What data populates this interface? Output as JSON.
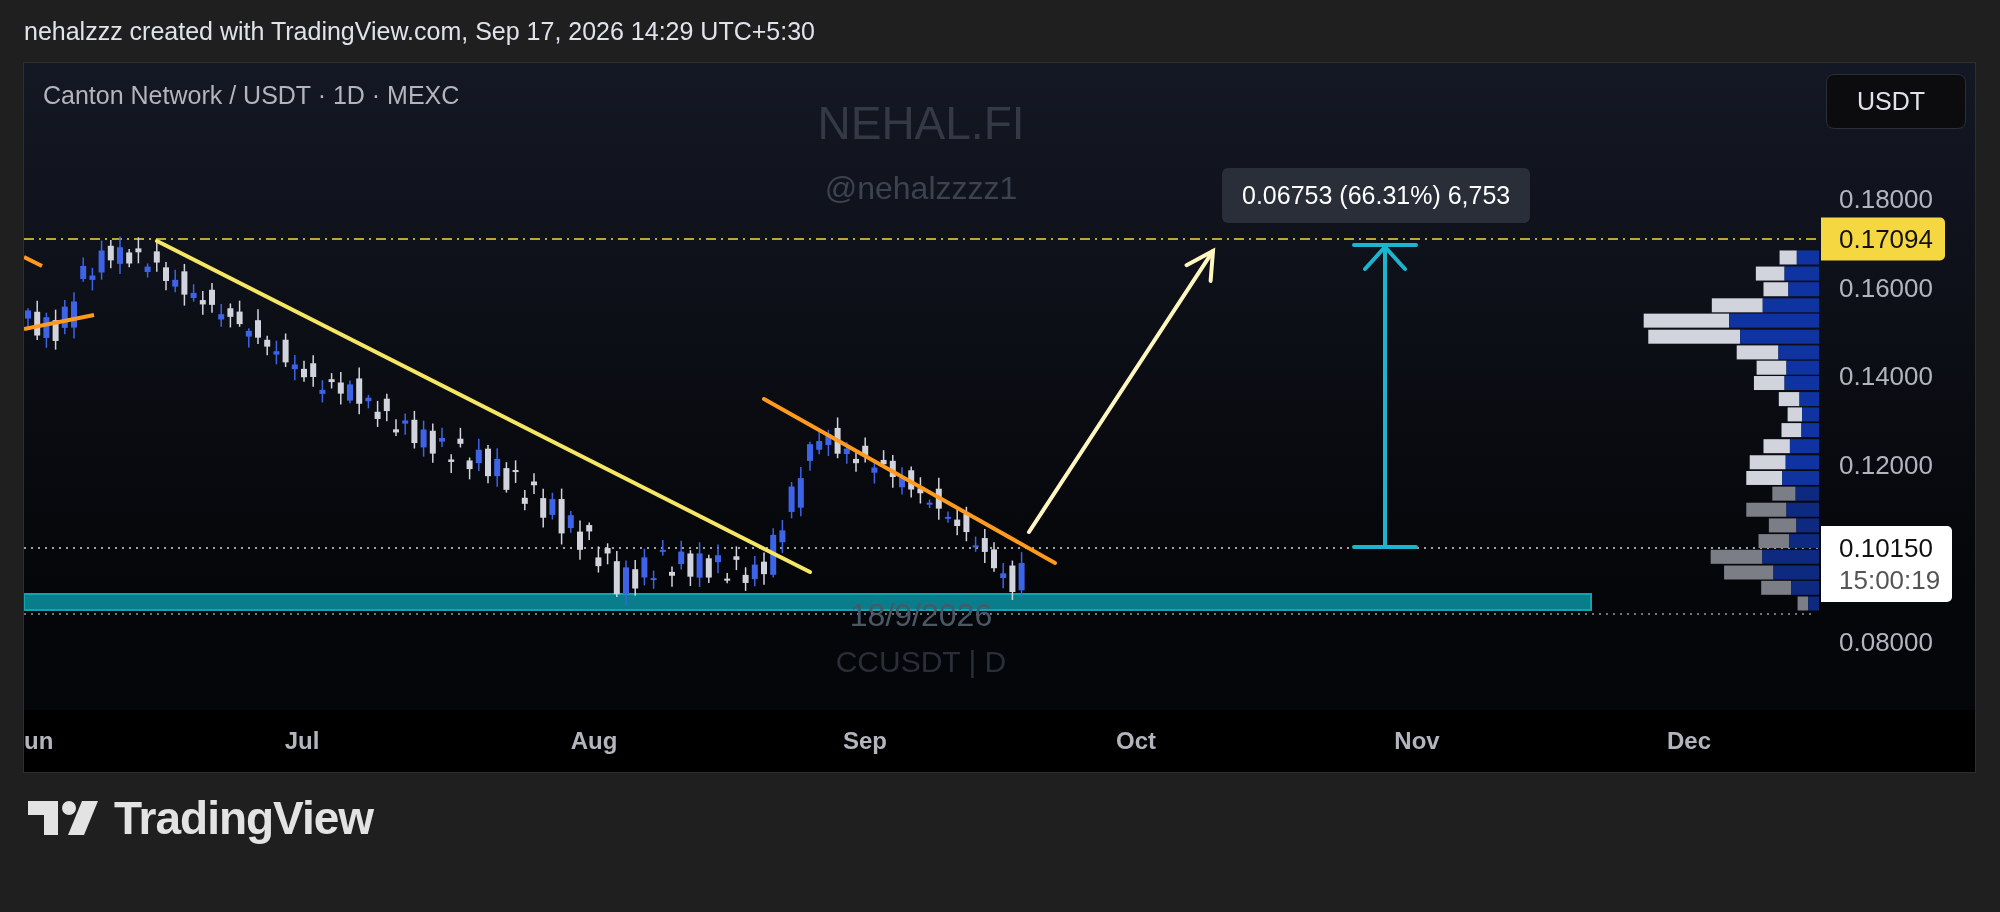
{
  "header": {
    "caption": "nehalzzz created with TradingView.com, Sep 17, 2026 14:29 UTC+5:30"
  },
  "chart": {
    "symbol_title": "Canton Network / USDT · 1D · MEXC",
    "currency_button": "USDT",
    "watermark": {
      "name": "NEHAL.FI",
      "handle": "@nehalzzzz1",
      "date": "18/9/2026",
      "ticker": "CCUSDT | D"
    },
    "measure_label": "0.06753 (66.31%) 6,753",
    "price_axis": [
      "0.18000",
      "0.16000",
      "0.14000",
      "0.12000",
      "0.08000"
    ],
    "price_tags": [
      {
        "kind": "target",
        "price": "0.17094"
      },
      {
        "kind": "last",
        "price": "0.10150",
        "countdown": "15:00:19"
      }
    ],
    "time_axis": [
      "un",
      "Jul",
      "Aug",
      "Sep",
      "Oct",
      "Nov",
      "Dec"
    ]
  },
  "footer": {
    "brand": "TradingView"
  }
}
